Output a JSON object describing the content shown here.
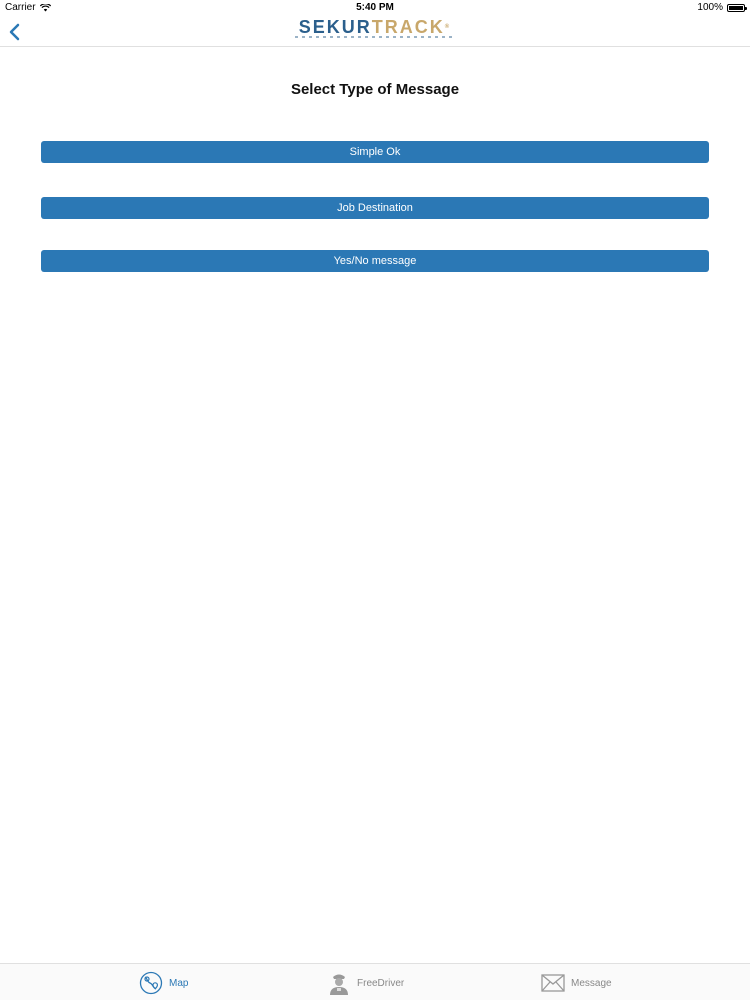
{
  "status_bar": {
    "carrier": "Carrier",
    "time": "5:40 PM",
    "battery": "100%",
    "battery_level": 1.0
  },
  "nav": {
    "logo_part1": "SEKUR",
    "logo_part2": "TRACK",
    "logo_reg": "®"
  },
  "page": {
    "title": "Select Type of Message"
  },
  "buttons": [
    {
      "label": "Simple Ok"
    },
    {
      "label": "Job Destination"
    },
    {
      "label": "Yes/No message"
    }
  ],
  "tabs": [
    {
      "label": "Map",
      "icon": "map-icon",
      "active": true
    },
    {
      "label": "FreeDriver",
      "icon": "driver-icon",
      "active": false
    },
    {
      "label": "Message",
      "icon": "envelope-icon",
      "active": false
    }
  ],
  "colors": {
    "accent": "#2b78b5",
    "logo_blue": "#2b5f8c",
    "logo_gold": "#c8a76a"
  }
}
